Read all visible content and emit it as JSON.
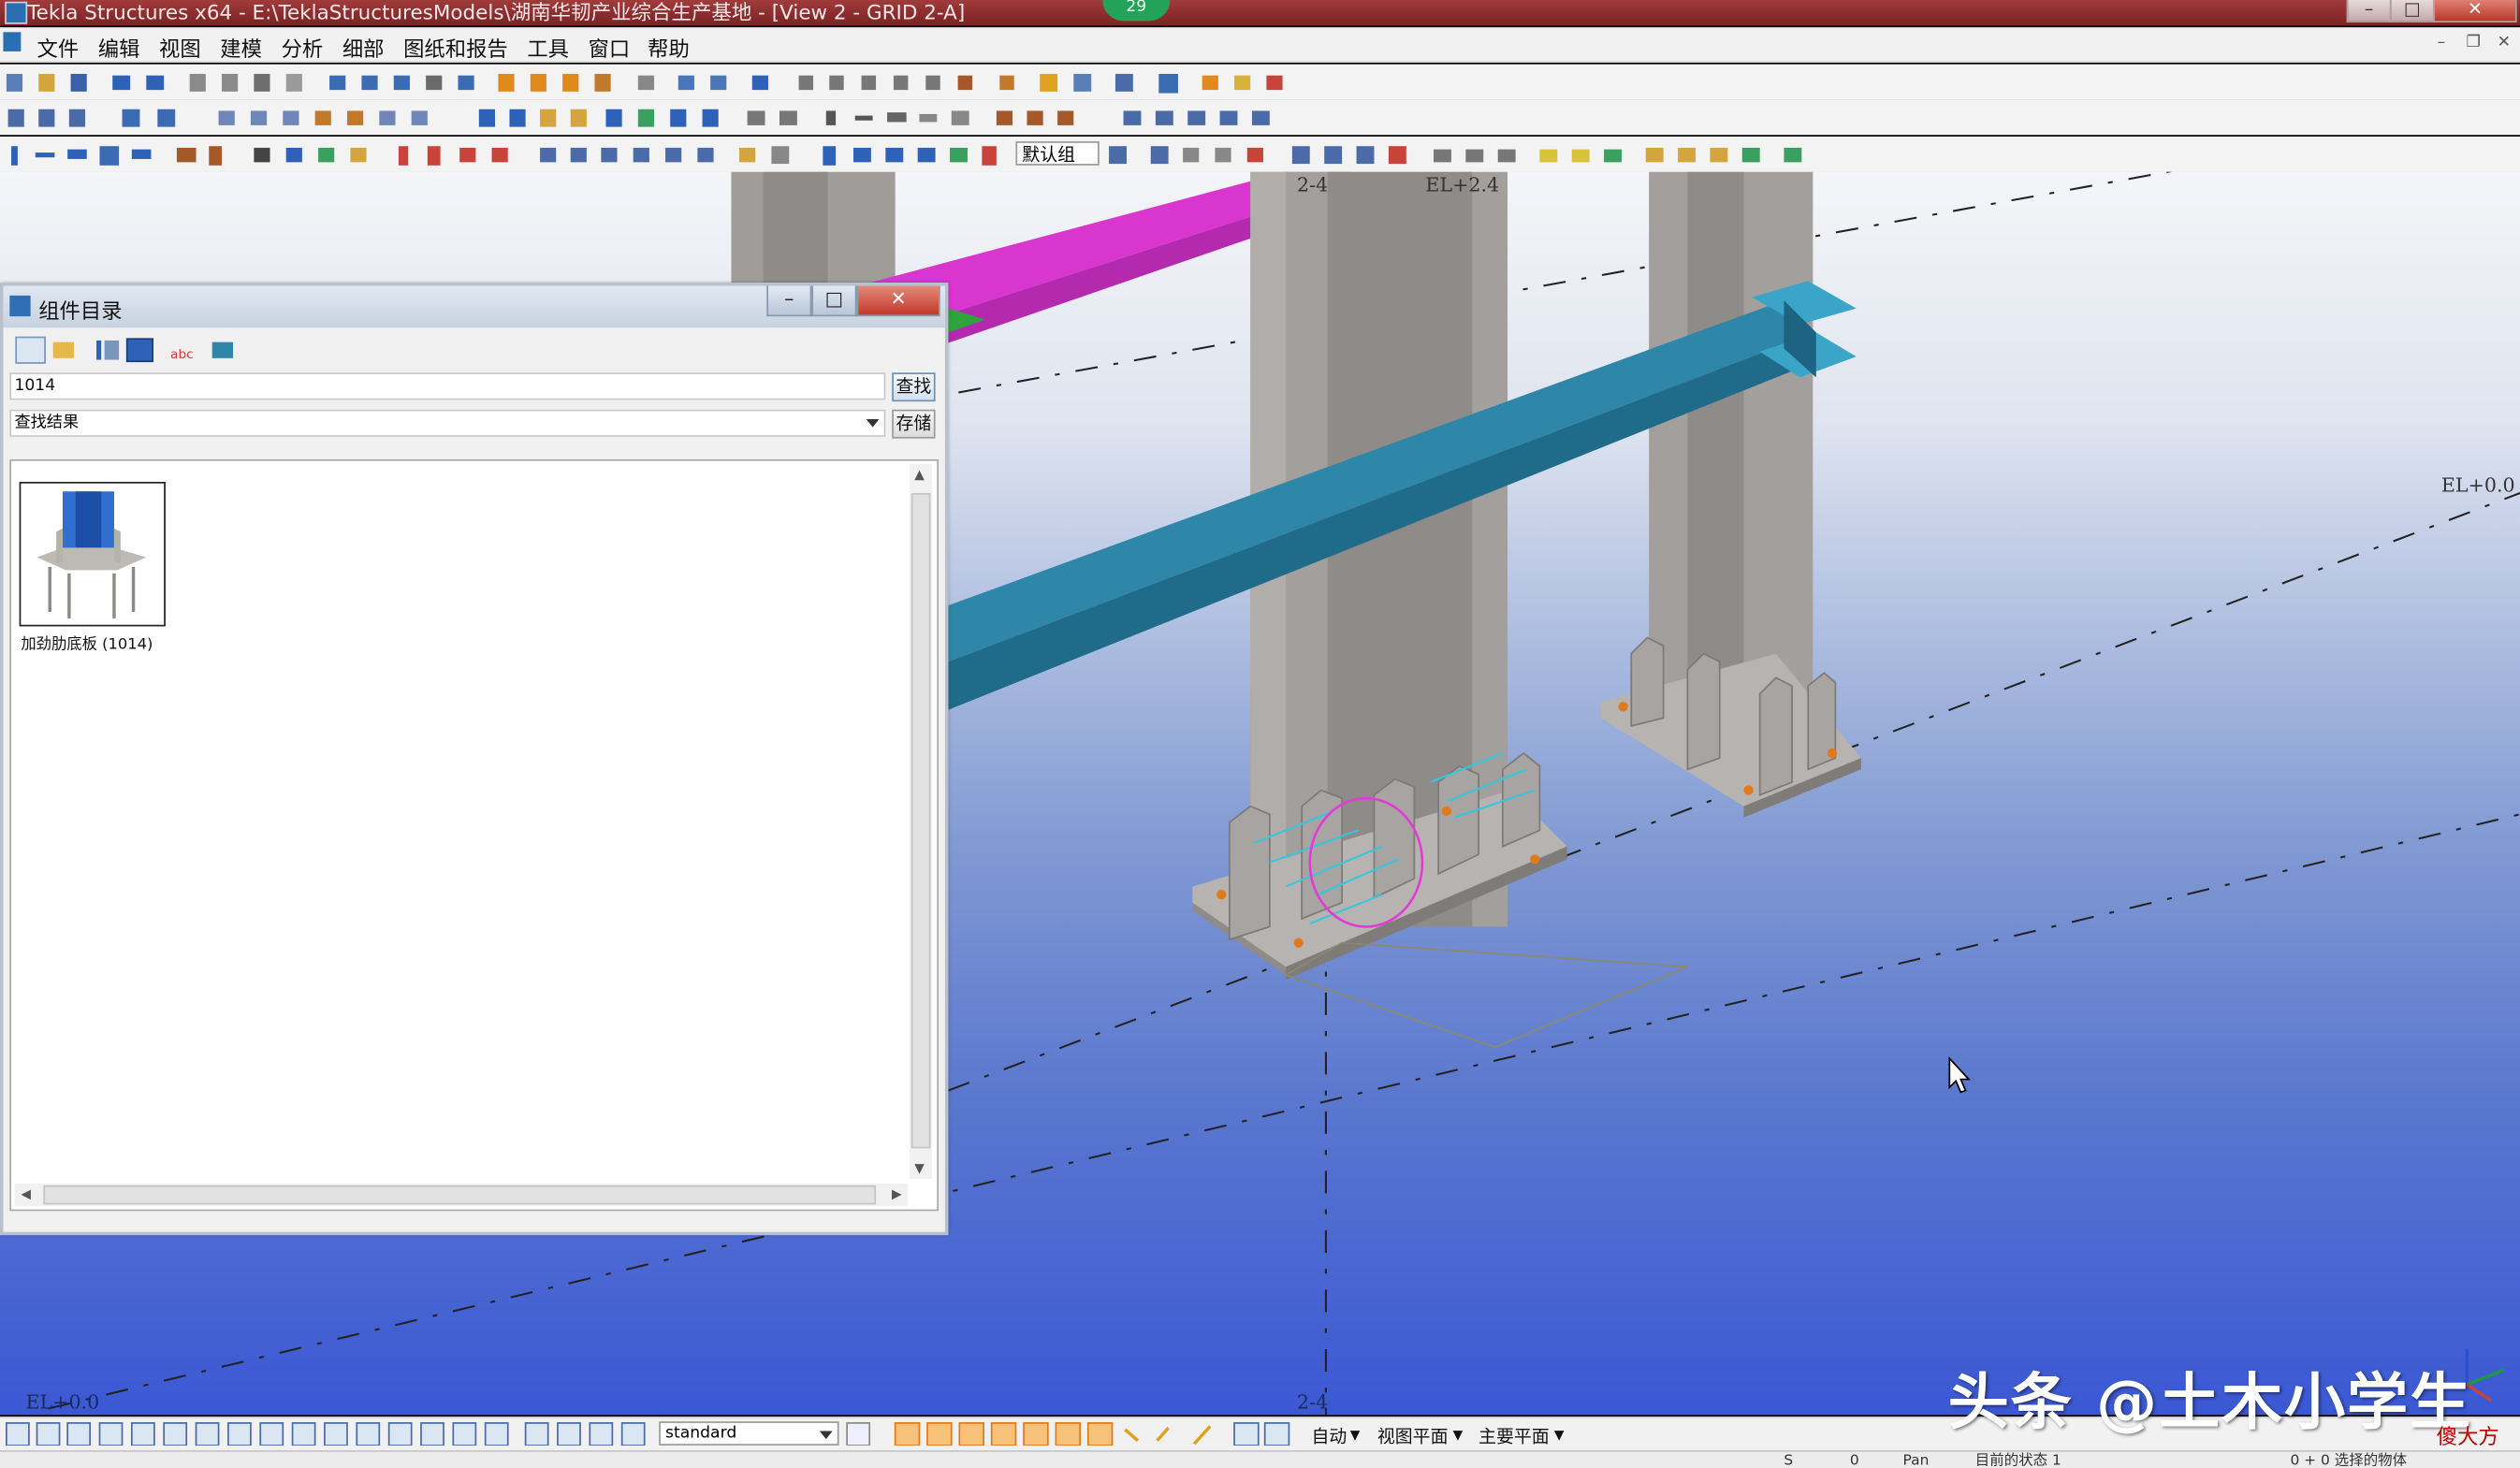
{
  "window": {
    "title": "Tekla Structures x64 - E:\\TeklaStructuresModels\\湖南华韧产业综合生产基地 - [View 2 - GRID 2-A]",
    "badge": "29",
    "minimize": "–",
    "maximize": "□",
    "close": "✕"
  },
  "menu": [
    "文件",
    "编辑",
    "视图",
    "建模",
    "分析",
    "细部",
    "图纸和报告",
    "工具",
    "窗口",
    "帮助"
  ],
  "toolbar": {
    "group_select": "默认组"
  },
  "viewport": {
    "labels": {
      "grid_top": "2-4",
      "elev_top": "EL+2.4",
      "elev_right": "EL+0.0",
      "elev_left": "EL+0.0",
      "grid_bottom": "2-4"
    }
  },
  "dialog": {
    "title": "组件目录",
    "search_value": "1014",
    "find_button": "查找",
    "result_combo": "查找结果",
    "save_button": "存储",
    "item_label": "加劲肋底板 (1014)",
    "minimize": "–",
    "maximize": "□",
    "close": "✕"
  },
  "bottom": {
    "standard": "standard",
    "snap_auto": "自动",
    "view_plane": "视图平面",
    "work_plane": "主要平面"
  },
  "status": {
    "s": "S",
    "zero": "0",
    "pan": "Pan",
    "state": "目前的状态 1",
    "selected": "0 + 0 选择的物体"
  },
  "watermark": {
    "main": "头条 @土木小学生",
    "corner": "傻大方"
  },
  "colors": {
    "title_bar": "#8a2b2c",
    "beam_blue": "#2e86a8",
    "beam_magenta": "#e23ad6",
    "column": "#a39f9c",
    "find_button": "#d5e1ef"
  }
}
